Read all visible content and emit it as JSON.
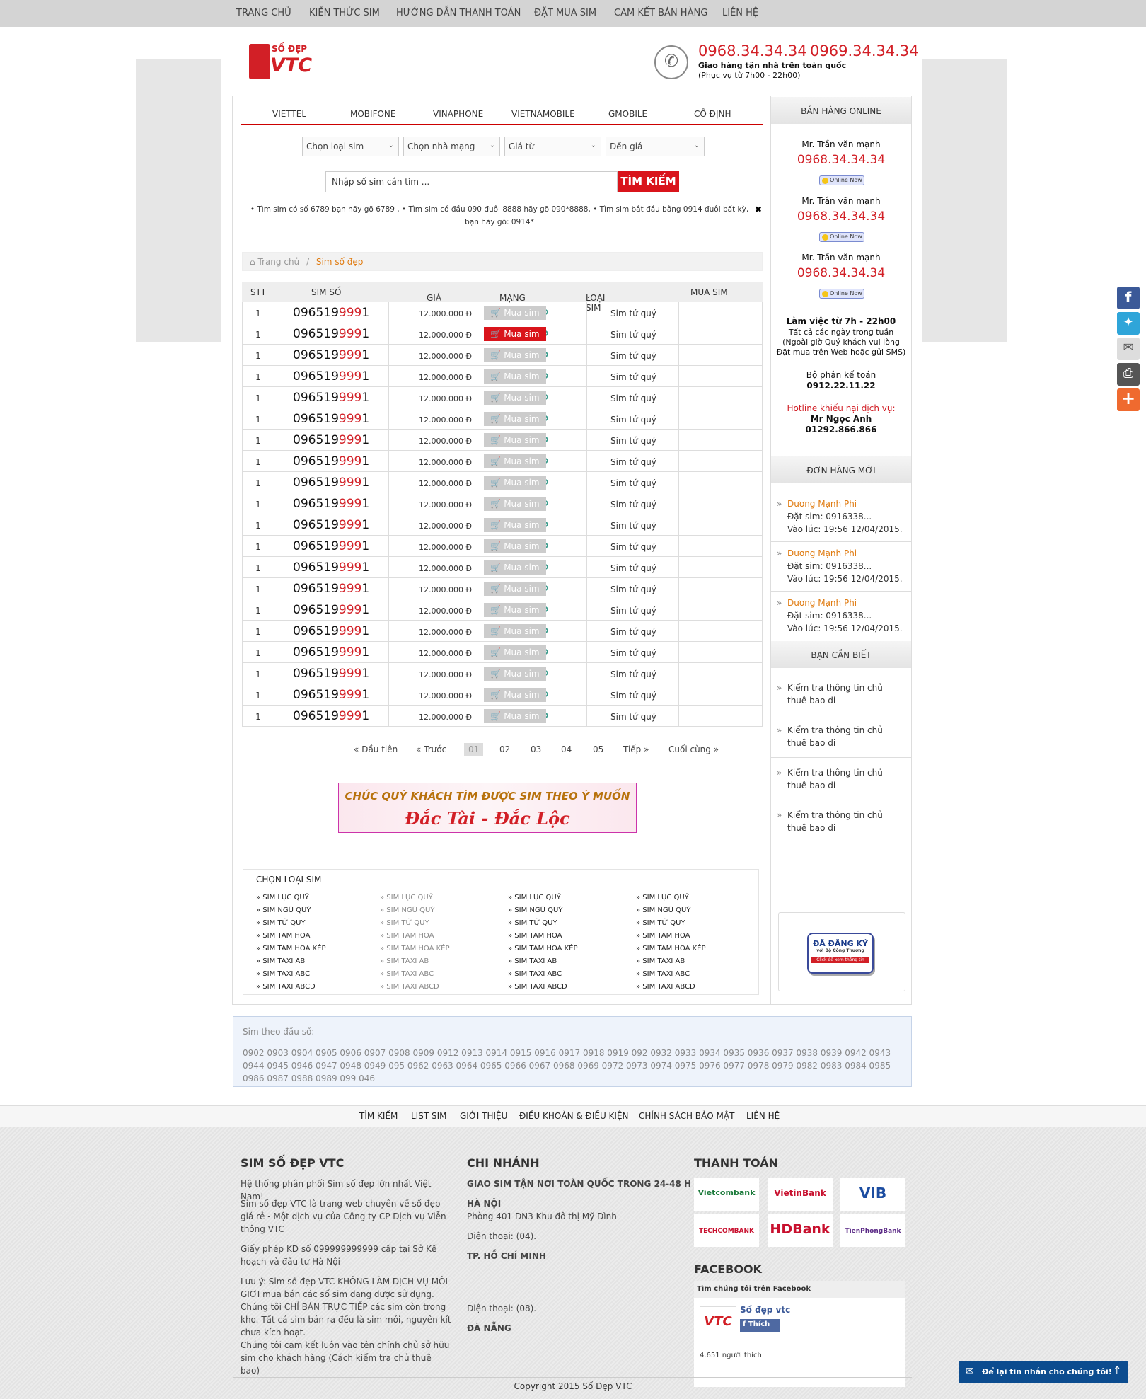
{
  "topnav": [
    "TRANG CHỦ",
    "KIẾN THỨC SIM",
    "HƯỚNG DẪN THANH TOÁN",
    "ĐẶT MUA SIM",
    "CAM KẾT BÁN HÀNG",
    "LIÊN HỆ"
  ],
  "logo": {
    "top": "SỐ ĐẸP",
    "bottom": "VTC"
  },
  "header": {
    "phone1": "0968.34.34.34",
    "phone2": "0969.34.34.34",
    "line1": "Giao hàng tận nhà trên toàn quốc",
    "line2": "(Phục vụ từ 7h00 - 22h00)"
  },
  "tabs": [
    "VIETTEL",
    "MOBIFONE",
    "VINAPHONE",
    "VIETNAMOBILE",
    "GMOBILE",
    "CỐ ĐỊNH"
  ],
  "filters": [
    "Chọn loại sim",
    "Chọn nhà mạng",
    "Giá từ",
    "Đến giá"
  ],
  "search": {
    "placeholder": "Nhập số sim cần tìm ...",
    "button": "TÌM KIẾM"
  },
  "tips": "• Tìm sim có số 6789 bạn hãy gõ 6789 , • Tìm sim có đầu 090 đuôi 8888 hãy gõ 090*8888, • Tìm sim bắt đầu bằng 0914 đuôi bất kỳ, bạn hãy gõ: 0914*",
  "tips_close": "✖",
  "breadcrumb": {
    "home": "Trang chủ",
    "sep": "/",
    "current": "Sim số đẹp"
  },
  "table": {
    "headers": [
      "STT",
      "SIM SỐ",
      "GIÁ",
      "MẠNG",
      "LOẠI SIM",
      "MUA SIM"
    ],
    "rows": [
      {
        "stt": "1",
        "pre": "096519",
        "hl": "999",
        "post": "1",
        "price": "12.000.000 Đ",
        "type": "Sim tứ quý",
        "buy": "Mua sim",
        "active": false
      },
      {
        "stt": "1",
        "pre": "096519",
        "hl": "999",
        "post": "1",
        "price": "12.000.000 Đ",
        "type": "Sim tứ quý",
        "buy": "Mua sim",
        "active": true
      },
      {
        "stt": "1",
        "pre": "096519",
        "hl": "999",
        "post": "1",
        "price": "12.000.000 Đ",
        "type": "Sim tứ quý",
        "buy": "Mua sim",
        "active": false
      },
      {
        "stt": "1",
        "pre": "096519",
        "hl": "999",
        "post": "1",
        "price": "12.000.000 Đ",
        "type": "Sim tứ quý",
        "buy": "Mua sim",
        "active": false
      },
      {
        "stt": "1",
        "pre": "096519",
        "hl": "999",
        "post": "1",
        "price": "12.000.000 Đ",
        "type": "Sim tứ quý",
        "buy": "Mua sim",
        "active": false
      },
      {
        "stt": "1",
        "pre": "096519",
        "hl": "999",
        "post": "1",
        "price": "12.000.000 Đ",
        "type": "Sim tứ quý",
        "buy": "Mua sim",
        "active": false
      },
      {
        "stt": "1",
        "pre": "096519",
        "hl": "999",
        "post": "1",
        "price": "12.000.000 Đ",
        "type": "Sim tứ quý",
        "buy": "Mua sim",
        "active": false
      },
      {
        "stt": "1",
        "pre": "096519",
        "hl": "999",
        "post": "1",
        "price": "12.000.000 Đ",
        "type": "Sim tứ quý",
        "buy": "Mua sim",
        "active": false
      },
      {
        "stt": "1",
        "pre": "096519",
        "hl": "999",
        "post": "1",
        "price": "12.000.000 Đ",
        "type": "Sim tứ quý",
        "buy": "Mua sim",
        "active": false
      },
      {
        "stt": "1",
        "pre": "096519",
        "hl": "999",
        "post": "1",
        "price": "12.000.000 Đ",
        "type": "Sim tứ quý",
        "buy": "Mua sim",
        "active": false
      },
      {
        "stt": "1",
        "pre": "096519",
        "hl": "999",
        "post": "1",
        "price": "12.000.000 Đ",
        "type": "Sim tứ quý",
        "buy": "Mua sim",
        "active": false
      },
      {
        "stt": "1",
        "pre": "096519",
        "hl": "999",
        "post": "1",
        "price": "12.000.000 Đ",
        "type": "Sim tứ quý",
        "buy": "Mua sim",
        "active": false
      },
      {
        "stt": "1",
        "pre": "096519",
        "hl": "999",
        "post": "1",
        "price": "12.000.000 Đ",
        "type": "Sim tứ quý",
        "buy": "Mua sim",
        "active": false
      },
      {
        "stt": "1",
        "pre": "096519",
        "hl": "999",
        "post": "1",
        "price": "12.000.000 Đ",
        "type": "Sim tứ quý",
        "buy": "Mua sim",
        "active": false
      },
      {
        "stt": "1",
        "pre": "096519",
        "hl": "999",
        "post": "1",
        "price": "12.000.000 Đ",
        "type": "Sim tứ quý",
        "buy": "Mua sim",
        "active": false
      },
      {
        "stt": "1",
        "pre": "096519",
        "hl": "999",
        "post": "1",
        "price": "12.000.000 Đ",
        "type": "Sim tứ quý",
        "buy": "Mua sim",
        "active": false
      },
      {
        "stt": "1",
        "pre": "096519",
        "hl": "999",
        "post": "1",
        "price": "12.000.000 Đ",
        "type": "Sim tứ quý",
        "buy": "Mua sim",
        "active": false
      },
      {
        "stt": "1",
        "pre": "096519",
        "hl": "999",
        "post": "1",
        "price": "12.000.000 Đ",
        "type": "Sim tứ quý",
        "buy": "Mua sim",
        "active": false
      },
      {
        "stt": "1",
        "pre": "096519",
        "hl": "999",
        "post": "1",
        "price": "12.000.000 Đ",
        "type": "Sim tứ quý",
        "buy": "Mua sim",
        "active": false
      },
      {
        "stt": "1",
        "pre": "096519",
        "hl": "999",
        "post": "1",
        "price": "12.000.000 Đ",
        "type": "Sim tứ quý",
        "buy": "Mua sim",
        "active": false
      }
    ]
  },
  "pagination": [
    "« Đầu tiên",
    "« Trước",
    "01",
    "02",
    "03",
    "04",
    "05",
    "Tiếp »",
    "Cuối cùng »"
  ],
  "banner": {
    "line1": "CHÚC QUÝ KHÁCH TÌM ĐƯỢC SIM THEO Ý MUỐN",
    "line2": "Đắc Tài - Đắc Lộc"
  },
  "categories": {
    "title": "CHỌN LOẠI SIM",
    "items": [
      "» SIM LỤC QUÝ",
      "» SIM NGŨ QUÝ",
      "» SIM TỨ QUÝ",
      "» SIM TAM HOA",
      "» SIM TAM HOA KÉP",
      "» SIM TAXI AB",
      "» SIM TAXI ABC",
      "» SIM TAXI ABCD"
    ]
  },
  "sidebar": {
    "online_title": "BÁN HÀNG ONLINE",
    "sellers": [
      {
        "name": "Mr. Trần văn mạnh",
        "phone": "0968.34.34.34",
        "status": "Online Now"
      },
      {
        "name": "Mr. Trần văn mạnh",
        "phone": "0968.34.34.34",
        "status": "Online Now"
      },
      {
        "name": "Mr. Trần văn mạnh",
        "phone": "0968.34.34.34",
        "status": "Online Now"
      }
    ],
    "hours_title": "Làm việc từ 7h - 22h00",
    "hours_lines": [
      "Tất cả các ngày trong tuần",
      "(Ngoài giờ Quý khách vui lòng",
      "Đặt mua trên Web hoặc gửi SMS)"
    ],
    "acct_label": "Bộ phận kế toán",
    "acct_phone": "0912.22.11.22",
    "complaint_label": "Hotline khiếu nại dịch vụ:",
    "complaint_name": "Mr Ngọc Anh",
    "complaint_phone": "01292.866.866",
    "orders_title": "ĐƠN HÀNG MỚI",
    "orders": [
      {
        "name": "Dương Mạnh Phi",
        "sim": "Đặt sim: 0916338...",
        "time": "Vào lúc: 19:56 12/04/2015."
      },
      {
        "name": "Dương Mạnh Phi",
        "sim": "Đặt sim: 0916338...",
        "time": "Vào lúc: 19:56 12/04/2015."
      },
      {
        "name": "Dương Mạnh Phi",
        "sim": "Đặt sim: 0916338...",
        "time": "Vào lúc: 19:56 12/04/2015."
      }
    ],
    "know_title": "BẠN CẦN BIẾT",
    "know_items": [
      "Kiểm tra thông tin chủ thuê bao di",
      "Kiểm tra thông tin chủ thuê bao di",
      "Kiểm tra thông tin chủ thuê bao di",
      "Kiểm tra thông tin chủ thuê bao di"
    ],
    "cert": {
      "l1": "ĐÃ ĐĂNG KÝ",
      "l2": "với Bộ Công Thương",
      "l3": "Click để xem thông tin"
    }
  },
  "dauso": {
    "title": "Sim theo đầu số:",
    "list": "0902 0903 0904 0905 0906 0907 0908 0909 0912 0913 0914 0915 0916 0917 0918 0919 092 0932 0933 0934 0935 0936 0937 0938 0939 0942 0943 0944 0945 0946 0947 0948 0949 095 0962 0963 0964 0965 0966 0967 0968 0969 0972 0973 0974 0975 0976 0977 0978 0979 0982 0983 0984 0985 0986 0987 0988 0989 099 046"
  },
  "footnav": [
    "TÌM KIẾM",
    "LIST SIM",
    "GIỚI THIỆU",
    "ĐIỀU KHOẢN & ĐIỀU KIỆN",
    "CHÍNH SÁCH BẢO MẬT",
    "LIÊN HỆ"
  ],
  "footer": {
    "col1_title": "SIM SỐ ĐẸP VTC",
    "col1_p1": "Hệ thống phân phối Sim số đẹp lớn nhất Việt Nam!",
    "col1_p2": "Sim số đẹp VTC là trang web chuyên về số đẹp giá rẻ - Một dịch vụ của Công ty CP Dịch vụ Viễn thông VTC",
    "col1_p3": "Giấy phép KD số 099999999999 cấp tại Sở Kế hoạch và đầu tư Hà Nội",
    "col1_p4": "Lưu ý: Sim số đẹp VTC KHÔNG LÀM DỊCH VỤ MÔI GIỚI mua bán các số sim đang được sử dụng. Chúng tôi CHỈ BÁN TRỰC TIẾP các sim còn trong kho. Tất cả sim bán ra đều là sim mới, nguyên kít chưa kích hoạt.",
    "col1_p5": "Chúng tôi cam kết luôn vào tên chính chủ sở hữu sim cho khách hàng (Cách kiểm tra chủ thuê bao)",
    "col2_title": "CHI NHÁNH",
    "col2_sub": "GIAO SIM TẬN NƠI TOÀN QUỐC TRONG 24-48 H",
    "hn": "HÀ NỘI",
    "hn_addr": "Phòng 401 DN3 Khu đô thị Mỹ Đình",
    "hn_phone": "Điện thoại: (04).",
    "hcm": "TP. HỒ CHÍ MINH",
    "hcm_phone": "Điện thoại: (08).",
    "dn": "ĐÀ NẴNG",
    "col3_title": "THANH TOÁN",
    "banks": [
      "Vietcombank",
      "VietinBank",
      "VIB",
      "TECHCOMBANK",
      "HDBank",
      "TienPhongBank"
    ],
    "fb_title": "FACEBOOK",
    "fb_find": "Tìm chúng tôi trên Facebook",
    "fb_page": "Số đẹp vtc",
    "fb_like": "Thích",
    "fb_count": "4.651 người thích",
    "copyright": "Copyright 2015 Số Đẹp VTC",
    "chat": "Để lại tin nhắn cho chúng tôi!"
  }
}
